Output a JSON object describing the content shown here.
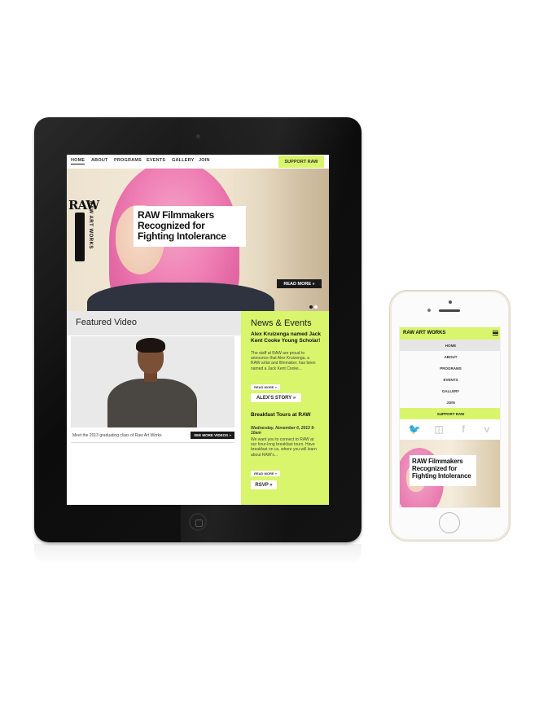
{
  "tablet": {
    "nav": {
      "items": [
        "HOME",
        "ABOUT",
        "PROGRAMS",
        "EVENTS",
        "GALLERY",
        "JOIN"
      ],
      "active": "HOME",
      "support_label": "SUPPORT RAW"
    },
    "hero": {
      "logo_text": "RAW",
      "logo_vertical": "RAW ART WORKS",
      "title": "RAW Filmmakers Recognized for Fighting Intolerance",
      "read_more_label": "READ MORE »",
      "slide_count": 2,
      "active_slide": 1
    },
    "featured": {
      "title": "Featured Video",
      "caption": "Meet the 2013 graduating class of Raw Art Works",
      "see_more_label": "SEE MORE VIDEOS »"
    },
    "news": {
      "title": "News & Events",
      "items": [
        {
          "headline": "Alex Kruizenga named Jack Kent Cooke Young Scholar!",
          "date": "",
          "body": "The staff at RAW are proud to announce that Alex Kruizenga, a RAW artist and filmmaker, has been named a Jack Kent Cooke...",
          "read_more_label": "READ MORE »",
          "button_label": "ALEX'S STORY »"
        },
        {
          "headline": "Breakfast Tours at RAW",
          "date": "Wednesday, November 6, 2013 9-10am",
          "body": "We want you to connect to RAW at our hour-long breakfast tours. Have breakfast on us, where you will learn about RAW's...",
          "read_more_label": "READ MORE »",
          "button_label": "RSVP »"
        }
      ]
    }
  },
  "phone": {
    "brand": "RAW ART WORKS",
    "menu_icon": "hamburger-icon",
    "nav_items": [
      "HOME",
      "ABOUT",
      "PROGRAMS",
      "EVENTS",
      "GALLERY",
      "JOIN"
    ],
    "active": "HOME",
    "support_label": "SUPPORT RAW",
    "social": [
      {
        "name": "twitter-icon",
        "glyph": "🐦"
      },
      {
        "name": "instagram-icon",
        "glyph": "◫"
      },
      {
        "name": "facebook-icon",
        "glyph": "f"
      },
      {
        "name": "vimeo-icon",
        "glyph": "v"
      }
    ],
    "hero_title": "RAW Filmmakers Recognized for Fighting Intolerance"
  },
  "colors": {
    "accent": "#d8f56b",
    "dark": "#1a1a1a",
    "device_frame": "#111111"
  }
}
